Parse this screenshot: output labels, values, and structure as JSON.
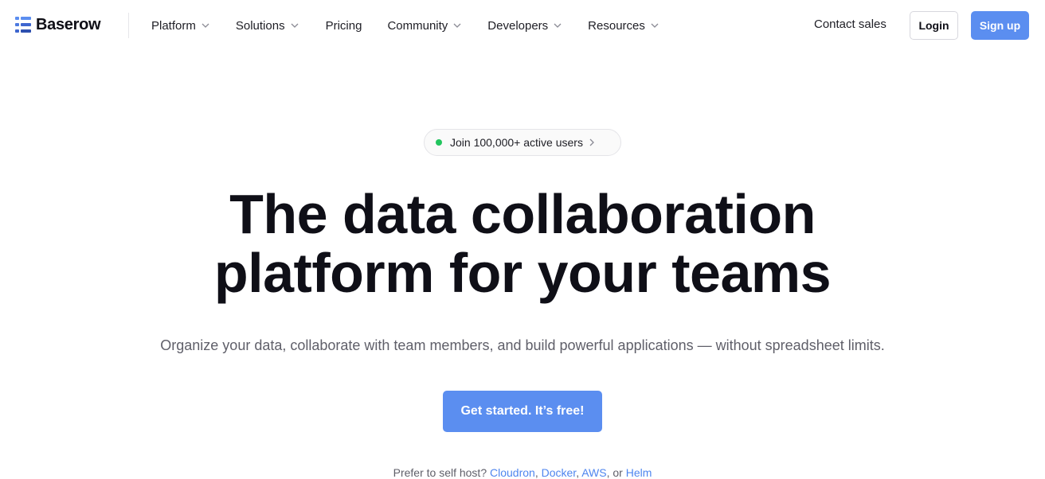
{
  "brand": {
    "name": "Baserow",
    "accent": "#5b8ef0",
    "logo_icon": "baserow-logo-icon"
  },
  "nav": {
    "items": [
      {
        "label": "Platform",
        "has_dropdown": true
      },
      {
        "label": "Solutions",
        "has_dropdown": true
      },
      {
        "label": "Pricing",
        "has_dropdown": false
      },
      {
        "label": "Community",
        "has_dropdown": true
      },
      {
        "label": "Developers",
        "has_dropdown": true
      },
      {
        "label": "Resources",
        "has_dropdown": true
      }
    ],
    "contact": "Contact sales",
    "login": "Login",
    "signup": "Sign up"
  },
  "hero": {
    "badge": {
      "text": "Join 100,000+ active users",
      "dot_color": "#22c55e",
      "icon": "chevron-right-icon"
    },
    "title_line1": "The data collaboration",
    "title_line2": "platform for your teams",
    "subtitle": "Organize your data, collaborate with team members, and build powerful applications — without spreadsheet limits.",
    "cta": "Get started. It’s free!",
    "selfhost": {
      "prefix": "Prefer to self host?",
      "links": [
        "Cloudron",
        "Docker",
        "AWS",
        "Helm"
      ],
      "sep": ",",
      "or": "or"
    }
  }
}
